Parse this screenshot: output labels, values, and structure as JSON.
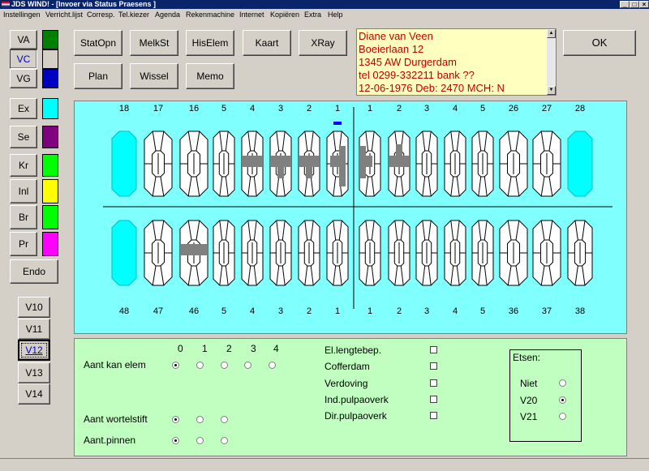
{
  "window": {
    "title": "JDS WIND!  - [Invoer via Status Praesens ]",
    "controls": [
      "_",
      "□",
      "×"
    ]
  },
  "menu": [
    "Instellingen",
    "Verricht.lijst",
    "Corresp.",
    "Tel.kiezer",
    "Agenda",
    "Rekenmachine",
    "Internet",
    "Kopiëren",
    "Extra",
    "Help"
  ],
  "left_buttons": [
    {
      "label": "VA",
      "color": "#008000"
    },
    {
      "label": "VC",
      "color": "#d4d0c8"
    },
    {
      "label": "VG",
      "color": "#0000c0"
    },
    {
      "label": "Ex",
      "color": "#00ffff"
    },
    {
      "label": "Se",
      "color": "#800080"
    },
    {
      "label": "Kr",
      "color": "#00ff00"
    },
    {
      "label": "Inl",
      "color": "#ffff00"
    },
    {
      "label": "Br",
      "color": "#00ff00"
    },
    {
      "label": "Pr",
      "color": "#ff00ff"
    },
    {
      "label": "Endo"
    }
  ],
  "visit_buttons": [
    "V10",
    "V11",
    "V12",
    "V13",
    "V14"
  ],
  "selected_visit": "V12",
  "toolbar": {
    "row1": [
      "StatOpn",
      "MelkSt",
      "HisElem",
      "Kaart",
      "XRay"
    ],
    "row2": [
      "Plan",
      "Wissel",
      "Memo"
    ],
    "ok": "OK"
  },
  "patient": {
    "lines": [
      "Diane van Veen",
      "Boeierlaan 12",
      "1345 AW  Durgerdam",
      "tel 0299-332211  bank ??",
      "12-06-1976  Deb: 2470   MCH: N"
    ]
  },
  "chart": {
    "upper_numbers": [
      "18",
      "17",
      "16",
      "5",
      "4",
      "3",
      "2",
      "1",
      "1",
      "2",
      "3",
      "4",
      "5",
      "26",
      "27",
      "28"
    ],
    "lower_numbers": [
      "48",
      "47",
      "46",
      "5",
      "4",
      "3",
      "2",
      "1",
      "1",
      "2",
      "3",
      "4",
      "5",
      "36",
      "37",
      "38"
    ],
    "absent_color": "#00ffff",
    "filling_color": "#808080",
    "background": "#80ffff"
  },
  "options": {
    "counts": [
      "0",
      "1",
      "2",
      "3",
      "4"
    ],
    "rows": [
      {
        "label": "Aant kan elem",
        "selected": 0,
        "options": 5
      },
      {
        "label": "Aant wortelstift",
        "selected": 0,
        "options": 3
      },
      {
        "label": "Aant.pinnen",
        "selected": 0,
        "options": 3
      }
    ],
    "checks": [
      {
        "label": "El.lengtebep.",
        "checked": false
      },
      {
        "label": "Cofferdam",
        "checked": false
      },
      {
        "label": "Verdoving",
        "checked": false
      },
      {
        "label": "Ind.pulpaoverk",
        "checked": false
      },
      {
        "label": "Dir.pulpaoverk",
        "checked": false
      }
    ],
    "etsen": {
      "title": "Etsen:",
      "items": [
        "Niet",
        "V20",
        "V21"
      ],
      "selected": "V20"
    }
  }
}
